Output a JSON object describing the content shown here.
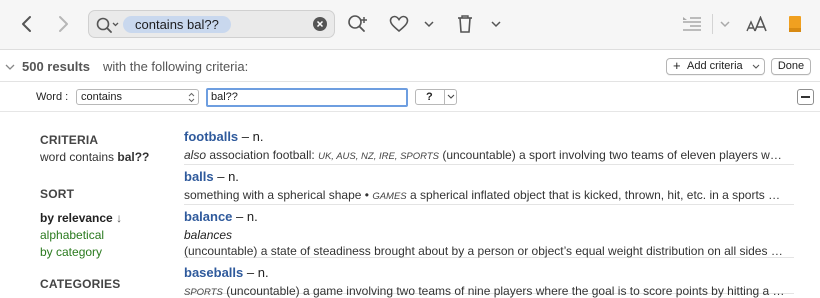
{
  "search": {
    "query": "contains bal??"
  },
  "criteria_bar": {
    "count": "500 results",
    "suffix": "with the following criteria:",
    "add_label": "Add criteria",
    "done_label": "Done"
  },
  "rule": {
    "field_label": "Word :",
    "operator": "contains",
    "value": "bal??",
    "wildcard": "?"
  },
  "sidebar": {
    "criteria_heading": "CRITERIA",
    "criteria_text": "word contains",
    "criteria_value": "bal??",
    "sort_heading": "SORT",
    "sort_options": [
      "by relevance",
      "alphabetical",
      "by category"
    ],
    "sort_arrow": "↓",
    "categories_heading": "CATEGORIES"
  },
  "results": [
    {
      "word": "footballs",
      "pos": "– n.",
      "line1": [
        {
          "t": "also",
          "c": "it"
        },
        {
          "t": " association football: "
        },
        {
          "t": "UK, AUS, NZ, IRE, SPORTS",
          "c": "sc"
        },
        {
          "t": " (uncountable) a sport involving two teams of eleven players w…"
        }
      ]
    },
    {
      "word": "balls",
      "pos": "– n.",
      "line1": [
        {
          "t": "something with a spherical shape • "
        },
        {
          "t": "GAMES",
          "c": "sc"
        },
        {
          "t": " a spherical inflated object that is kicked, thrown, hit, etc. in a sports …"
        }
      ]
    },
    {
      "word": "balance",
      "pos": "– n.",
      "inflection": "balances",
      "line1": [
        {
          "t": "(uncountable) a state of steadiness brought about by a person or object’s equal weight distribution on all sides …"
        }
      ]
    },
    {
      "word": "baseballs",
      "pos": "– n.",
      "line1": [
        {
          "t": "SPORTS",
          "c": "sc"
        },
        {
          "t": " (uncountable) a game involving two teams of nine players where the goal is to score points by hitting a …"
        }
      ]
    }
  ],
  "colors": {
    "accent": "#2f5a9c",
    "sort_green": "#2a7a1e",
    "token": "#c9d8ee",
    "bookmark": "#f0a020"
  }
}
